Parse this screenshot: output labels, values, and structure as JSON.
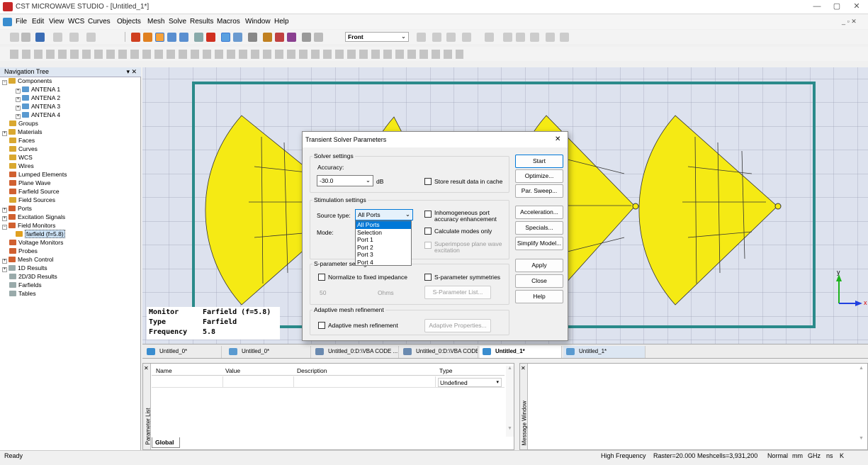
{
  "window": {
    "title": "CST MICROWAVE STUDIO - [Untitled_1*]"
  },
  "menu": [
    "File",
    "Edit",
    "View",
    "WCS",
    "Curves",
    "Objects",
    "Mesh",
    "Solve",
    "Results",
    "Macros",
    "Window",
    "Help"
  ],
  "toolbar": {
    "view_select": "Front"
  },
  "nav": {
    "header": "Navigation Tree",
    "items": [
      "Components",
      "ANTENA 1",
      "ANTENA 2",
      "ANTENA 3",
      "ANTENA 4",
      "Groups",
      "Materials",
      "Faces",
      "Curves",
      "WCS",
      "Wires",
      "Lumped Elements",
      "Plane Wave",
      "Farfield Source",
      "Field Sources",
      "Ports",
      "Excitation Signals",
      "Field Monitors",
      "farfield (f=5.8)",
      "Voltage Monitors",
      "Probes",
      "Mesh Control",
      "1D Results",
      "2D/3D Results",
      "Farfields",
      "Tables"
    ]
  },
  "monitor_info": {
    "monitor_label": "Monitor",
    "monitor_value": "Farfield (f=5.8)",
    "type_label": "Type",
    "type_value": "Farfield",
    "freq_label": "Frequency",
    "freq_value": "5.8"
  },
  "axes": {
    "y": "y",
    "x": "x"
  },
  "dialog": {
    "title": "Transient Solver Parameters",
    "close": "✕",
    "solver_settings": "Solver settings",
    "accuracy_label": "Accuracy:",
    "accuracy_value": "-30.0",
    "accuracy_unit": "dB",
    "store_cache": "Store result data in cache",
    "stimulation_settings": "Stimulation settings",
    "source_type_label": "Source type:",
    "source_type_value": "All Ports",
    "source_options": [
      "All Ports",
      "Selection",
      "Port 1",
      "Port 2",
      "Port 3",
      "Port 4"
    ],
    "inhomogeneous": "Inhomogeneous port accuracy enhancement",
    "mode_label": "Mode:",
    "calc_modes": "Calculate modes only",
    "superimpose": "Superimpose plane wave excitation",
    "sparam_settings": "S-parameter settings",
    "normalize": "Normalize to fixed impedance",
    "sparam_sym": "S-parameter symmetries",
    "impedance_value": "50",
    "impedance_unit": "Ohms",
    "sparam_list": "S-Parameter List...",
    "adaptive_group": "Adaptive mesh refinement",
    "adaptive_check": "Adaptive mesh refinement",
    "adaptive_props": "Adaptive Properties...",
    "buttons": {
      "start": "Start",
      "optimize": "Optimize...",
      "par_sweep": "Par. Sweep...",
      "acceleration": "Acceleration...",
      "specials": "Specials...",
      "simplify": "Simplify Model...",
      "apply": "Apply",
      "close": "Close",
      "help": "Help"
    }
  },
  "doc_tabs": [
    "Untitled_0*",
    "Untitled_0*",
    "Untitled_0:D:\\VBA CODE ...",
    "Untitled_0:D:\\VBA CODE ...",
    "Untitled_1*",
    "Untitled_1*"
  ],
  "param_list": {
    "columns": [
      "Name",
      "Value",
      "Description",
      "Type"
    ],
    "type_value": "Undefined",
    "side_label": "Parameter List",
    "tab": "Global"
  },
  "message_window": {
    "side_label": "Message Window"
  },
  "status": {
    "left": "Ready",
    "right": [
      "High Frequency",
      "Raster=20.000",
      "Meshcells=3,931,200",
      "Normal",
      "mm",
      "GHz",
      "ns",
      "K"
    ]
  },
  "colors": {
    "antenna": "#f5ea14",
    "boundary": "#2a8a8a",
    "viewport_bg": "#dde2ee",
    "selection": "#0078d7"
  }
}
